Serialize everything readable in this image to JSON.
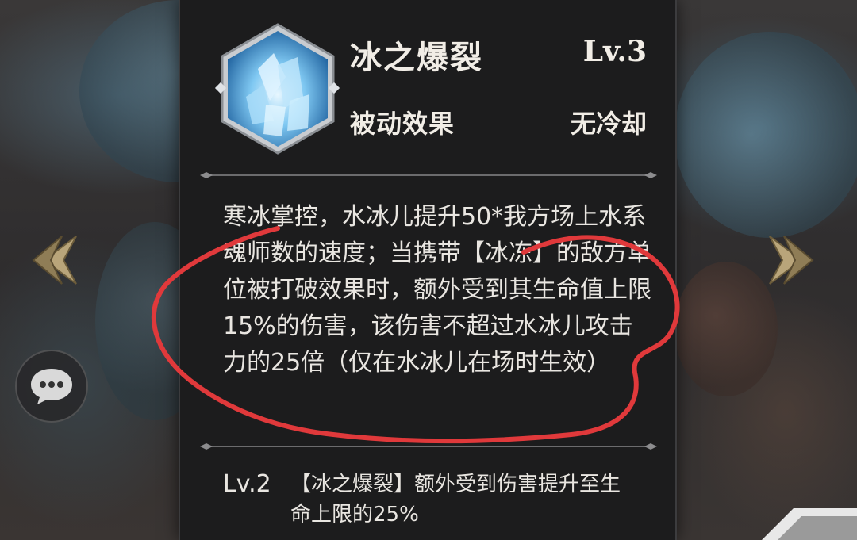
{
  "skill": {
    "name": "冰之爆裂",
    "level": "Lv.3",
    "type": "被动效果",
    "cooldown": "无冷却",
    "icon": "ice-crystal-icon",
    "description": "寒冰掌控，水冰儿提升50*我方场上水系魂师数的速度；当携带【冰冻】的敌方单位被打破效果时，额外受到其生命值上限15%的伤害，该伤害不超过水冰儿攻击力的25倍（仅在水冰儿在场时生效）"
  },
  "upgrades": [
    {
      "level": "Lv.2",
      "text": "【冰之爆裂】额外受到伤害提升至生命上限的25%"
    }
  ],
  "colors": {
    "panel_bg": "#1c1c1d",
    "text": "#e9e6e1",
    "annotation": "#e0393b",
    "icon_blue": "#5fb4ea"
  }
}
